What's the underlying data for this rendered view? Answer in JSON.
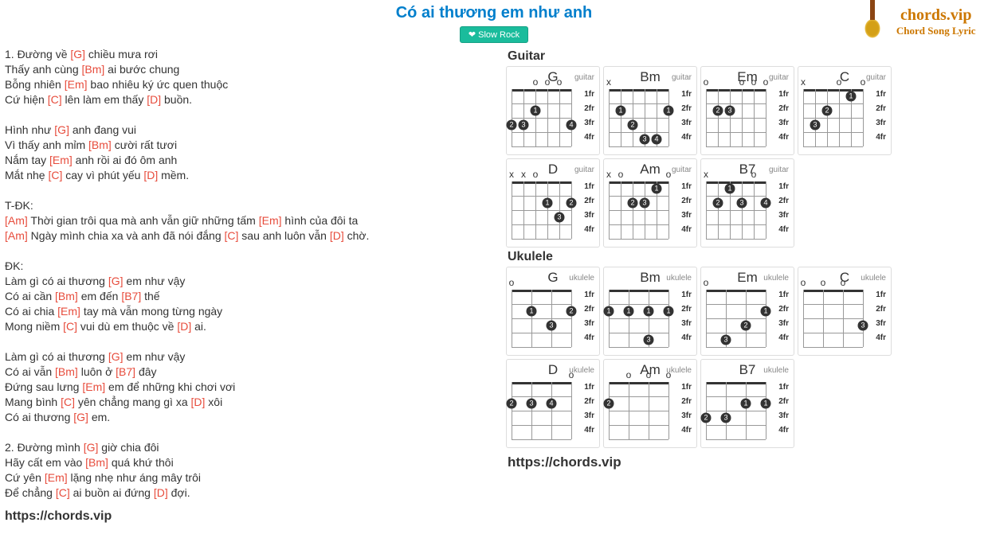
{
  "title": "Có ai thương em như anh",
  "genre": "Slow Rock",
  "logo": {
    "line1": "chords.vip",
    "line2": "Chord Song Lyric"
  },
  "footer_url": "https://chords.vip",
  "panel_url": "https://chords.vip",
  "sections": {
    "guitar": "Guitar",
    "ukulele": "Ukulele"
  },
  "fret_labels": [
    "1fr",
    "2fr",
    "3fr",
    "4fr"
  ],
  "lyrics": [
    [
      [
        "",
        "1. Đường về "
      ],
      [
        "G",
        " chiều mưa rơi"
      ]
    ],
    [
      [
        "",
        "Thấy anh cùng "
      ],
      [
        "Bm",
        " ai bước chung"
      ]
    ],
    [
      [
        "",
        "Bỗng nhiên "
      ],
      [
        "Em",
        " bao nhiêu ký ức quen thuộc"
      ]
    ],
    [
      [
        "",
        "Cứ hiện "
      ],
      [
        "C",
        " lên làm em thấy "
      ],
      [
        "D",
        " buồn."
      ]
    ],
    [],
    [
      [
        "",
        "Hình như "
      ],
      [
        "G",
        " anh đang vui"
      ]
    ],
    [
      [
        "",
        "Vì thấy anh mỉm "
      ],
      [
        "Bm",
        " cười rất tươi"
      ]
    ],
    [
      [
        "",
        "Nắm tay "
      ],
      [
        "Em",
        " anh rồi ai đó ôm anh"
      ]
    ],
    [
      [
        "",
        "Mắt nhẹ "
      ],
      [
        "C",
        " cay vì phút yếu "
      ],
      [
        "D",
        " mềm."
      ]
    ],
    [],
    [
      [
        "",
        "T-ĐK:"
      ]
    ],
    [
      [
        "Am",
        " Thời gian trôi qua mà anh vẫn giữ những tấm "
      ],
      [
        "Em",
        " hình của đôi ta"
      ]
    ],
    [
      [
        "Am",
        " Ngày mình chia xa và anh đã nói đắng "
      ],
      [
        "C",
        " sau anh luôn vẫn "
      ],
      [
        "D",
        " chờ."
      ]
    ],
    [],
    [
      [
        "",
        "ĐK:"
      ]
    ],
    [
      [
        "",
        "Làm gì có ai thương "
      ],
      [
        "G",
        " em như vậy"
      ]
    ],
    [
      [
        "",
        "Có ai cần "
      ],
      [
        "Bm",
        " em đến "
      ],
      [
        "B7",
        " thế"
      ]
    ],
    [
      [
        "",
        "Có ai chia "
      ],
      [
        "Em",
        " tay mà vẫn mong từng ngày"
      ]
    ],
    [
      [
        "",
        "Mong niềm "
      ],
      [
        "C",
        " vui dù em thuộc về "
      ],
      [
        "D",
        " ai."
      ]
    ],
    [],
    [
      [
        "",
        "Làm gì có ai thương "
      ],
      [
        "G",
        " em như vậy"
      ]
    ],
    [
      [
        "",
        "Có ai vẫn "
      ],
      [
        "Bm",
        " luôn ở "
      ],
      [
        "B7",
        " đây"
      ]
    ],
    [
      [
        "",
        "Đứng sau lưng "
      ],
      [
        "Em",
        " em để những khi chơi vơi"
      ]
    ],
    [
      [
        "",
        "Mang bình "
      ],
      [
        "C",
        " yên chẳng mang gì xa "
      ],
      [
        "D",
        " xôi"
      ]
    ],
    [
      [
        "",
        "Có ai thương "
      ],
      [
        "G",
        " em."
      ]
    ],
    [],
    [
      [
        "",
        "2. Đường mình "
      ],
      [
        "G",
        " giờ chia đôi"
      ]
    ],
    [
      [
        "",
        "Hãy cất em vào "
      ],
      [
        "Bm",
        " quá khứ thôi"
      ]
    ],
    [
      [
        "",
        "Cứ yên "
      ],
      [
        "Em",
        " lặng nhẹ như áng mây trôi"
      ]
    ],
    [
      [
        "",
        "Để chẳng "
      ],
      [
        "C",
        " ai buồn ai đứng "
      ],
      [
        "D",
        " đợi."
      ]
    ]
  ],
  "guitar": {
    "strings": 6,
    "chords": [
      {
        "name": "G",
        "type": "guitar",
        "markers": [
          "",
          "",
          "o",
          "o",
          "o",
          ""
        ],
        "dots": [
          [
            2,
            1,
            "1"
          ],
          [
            0,
            2,
            "2"
          ],
          [
            1,
            2,
            "3"
          ],
          [
            5,
            2,
            "4"
          ]
        ]
      },
      {
        "name": "Bm",
        "type": "guitar",
        "markers": [
          "x",
          "",
          "",
          "",
          "",
          ""
        ],
        "dots": [
          [
            1,
            1,
            "1"
          ],
          [
            5,
            1,
            "1"
          ],
          [
            2,
            2,
            "2"
          ],
          [
            3,
            3,
            "3"
          ],
          [
            4,
            3,
            "4"
          ]
        ]
      },
      {
        "name": "Em",
        "type": "guitar",
        "markers": [
          "o",
          "",
          "",
          "o",
          "o",
          "o"
        ],
        "dots": [
          [
            1,
            1,
            "2"
          ],
          [
            2,
            1,
            "3"
          ]
        ]
      },
      {
        "name": "C",
        "type": "guitar",
        "markers": [
          "x",
          "",
          "",
          "o",
          "",
          "o"
        ],
        "dots": [
          [
            4,
            0,
            "1"
          ],
          [
            2,
            1,
            "2"
          ],
          [
            1,
            2,
            "3"
          ]
        ]
      },
      {
        "name": "D",
        "type": "guitar",
        "markers": [
          "x",
          "x",
          "o",
          "",
          "",
          ""
        ],
        "dots": [
          [
            3,
            1,
            "1"
          ],
          [
            5,
            1,
            "2"
          ],
          [
            4,
            2,
            "3"
          ]
        ]
      },
      {
        "name": "Am",
        "type": "guitar",
        "markers": [
          "x",
          "o",
          "",
          "",
          "",
          "o"
        ],
        "dots": [
          [
            4,
            0,
            "1"
          ],
          [
            2,
            1,
            "2"
          ],
          [
            3,
            1,
            "3"
          ]
        ]
      },
      {
        "name": "B7",
        "type": "guitar",
        "markers": [
          "x",
          "",
          "",
          "",
          "o",
          ""
        ],
        "dots": [
          [
            2,
            0,
            "1"
          ],
          [
            1,
            1,
            "2"
          ],
          [
            3,
            1,
            "3"
          ],
          [
            5,
            1,
            "4"
          ]
        ]
      }
    ]
  },
  "ukulele": {
    "strings": 4,
    "chords": [
      {
        "name": "G",
        "type": "ukulele",
        "markers": [
          "o",
          "",
          "",
          ""
        ],
        "dots": [
          [
            1,
            1,
            "1"
          ],
          [
            3,
            1,
            "2"
          ],
          [
            2,
            2,
            "3"
          ]
        ]
      },
      {
        "name": "Bm",
        "type": "ukulele",
        "markers": [
          "",
          "",
          "",
          ""
        ],
        "dots": [
          [
            0,
            1,
            "1"
          ],
          [
            1,
            1,
            "1"
          ],
          [
            2,
            1,
            "1"
          ],
          [
            3,
            1,
            "1"
          ],
          [
            2,
            3,
            "3"
          ]
        ]
      },
      {
        "name": "Em",
        "type": "ukulele",
        "markers": [
          "o",
          "",
          "",
          ""
        ],
        "dots": [
          [
            3,
            1,
            "1"
          ],
          [
            2,
            2,
            "2"
          ],
          [
            1,
            3,
            "3"
          ]
        ]
      },
      {
        "name": "C",
        "type": "ukulele",
        "markers": [
          "o",
          "o",
          "o",
          ""
        ],
        "dots": [
          [
            3,
            2,
            "3"
          ]
        ]
      },
      {
        "name": "D",
        "type": "ukulele",
        "markers": [
          "",
          "",
          "",
          "o"
        ],
        "dots": [
          [
            0,
            1,
            "2"
          ],
          [
            1,
            1,
            "3"
          ],
          [
            2,
            1,
            "4"
          ]
        ]
      },
      {
        "name": "Am",
        "type": "ukulele",
        "markers": [
          "",
          "o",
          "o",
          "o"
        ],
        "dots": [
          [
            0,
            1,
            "2"
          ]
        ]
      },
      {
        "name": "B7",
        "type": "ukulele",
        "markers": [
          "",
          "",
          "",
          ""
        ],
        "dots": [
          [
            2,
            1,
            "1"
          ],
          [
            3,
            1,
            "1"
          ],
          [
            0,
            2,
            "2"
          ],
          [
            1,
            2,
            "3"
          ]
        ]
      }
    ]
  }
}
